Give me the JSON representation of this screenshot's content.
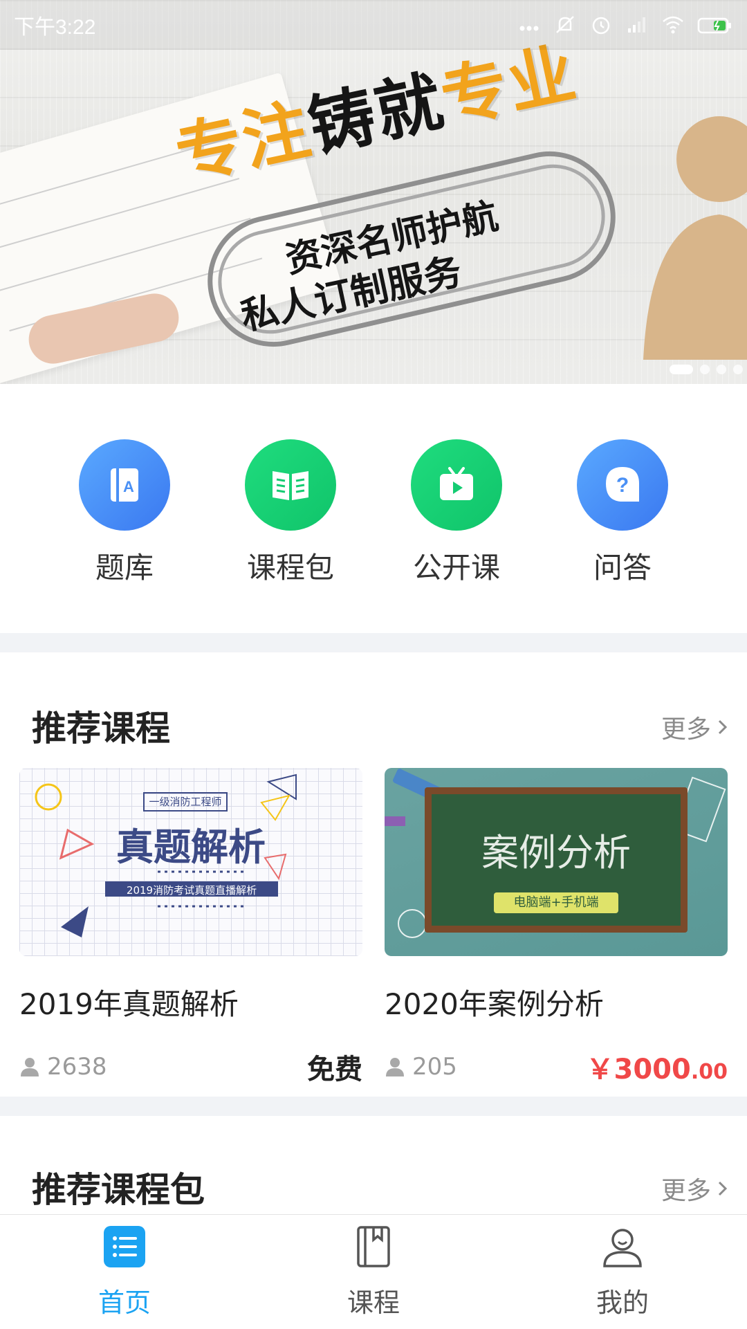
{
  "status_bar": {
    "time": "下午3:22",
    "icons": [
      "more-dots-icon",
      "notifications-muted-icon",
      "alarm-icon",
      "signal-icon",
      "wifi-icon",
      "battery-charging-icon"
    ]
  },
  "banner": {
    "title_orange_1": "专注",
    "title_black": "铸就",
    "title_orange_2": "专业",
    "subtitle_1": "资深名师护航",
    "subtitle_2": "私人订制服务",
    "slide_count": 4,
    "active_slide": 1
  },
  "quick_nav": [
    {
      "label": "题库",
      "icon": "question-bank-icon",
      "color": "#4a90f5"
    },
    {
      "label": "课程包",
      "icon": "course-package-icon",
      "color": "#14cc72"
    },
    {
      "label": "公开课",
      "icon": "open-class-tv-icon",
      "color": "#14cc72"
    },
    {
      "label": "问答",
      "icon": "qa-bubble-icon",
      "color": "#4a90f5"
    }
  ],
  "recommend_courses": {
    "title": "推荐课程",
    "more": "更多",
    "items": [
      {
        "title": "2019年真题解析",
        "thumb_tag": "一级消防工程师",
        "thumb_title": "真题解析",
        "thumb_sub": "2019消防考试真题直播解析",
        "students": "2638",
        "price": "免费"
      },
      {
        "title": "2020年案例分析",
        "thumb_title": "案例分析",
        "thumb_sub": "电脑端+手机端",
        "students": "205",
        "price_symbol": "￥",
        "price_int": "3000",
        "price_dec": ".00"
      }
    ]
  },
  "recommend_packages": {
    "title": "推荐课程包",
    "more": "更多"
  },
  "bottom_nav": [
    {
      "label": "首页",
      "icon": "home-list-icon",
      "active": true
    },
    {
      "label": "课程",
      "icon": "course-book-icon",
      "active": false
    },
    {
      "label": "我的",
      "icon": "profile-user-icon",
      "active": false
    }
  ],
  "colors": {
    "accent": "#1ba3f2",
    "price_red": "#f04848",
    "banner_orange": "#f2a31c",
    "qn_blue": "#4a90f5",
    "qn_green": "#14cc72"
  }
}
